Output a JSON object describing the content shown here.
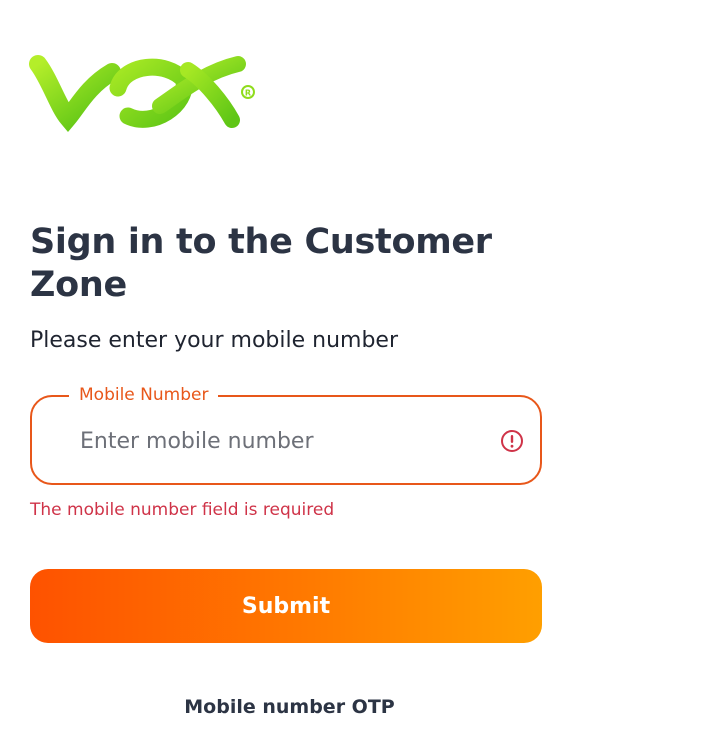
{
  "brand": {
    "name": "VOX",
    "logo_icon": "vox-logo",
    "colors": {
      "logo_green": "#8fdc1c",
      "accent_orange": "#e8571a",
      "error_red": "#cf3348",
      "heading": "#2c3444"
    }
  },
  "page": {
    "title": "Sign in to the Customer Zone",
    "subtitle": "Please enter your mobile number"
  },
  "form": {
    "mobile": {
      "label": "Mobile Number",
      "placeholder": "Enter mobile number",
      "value": "",
      "status_icon": "error-circle-icon",
      "error": "The mobile number field is required"
    },
    "submit_label": "Submit"
  },
  "alt_login": {
    "label": "Mobile number OTP"
  }
}
